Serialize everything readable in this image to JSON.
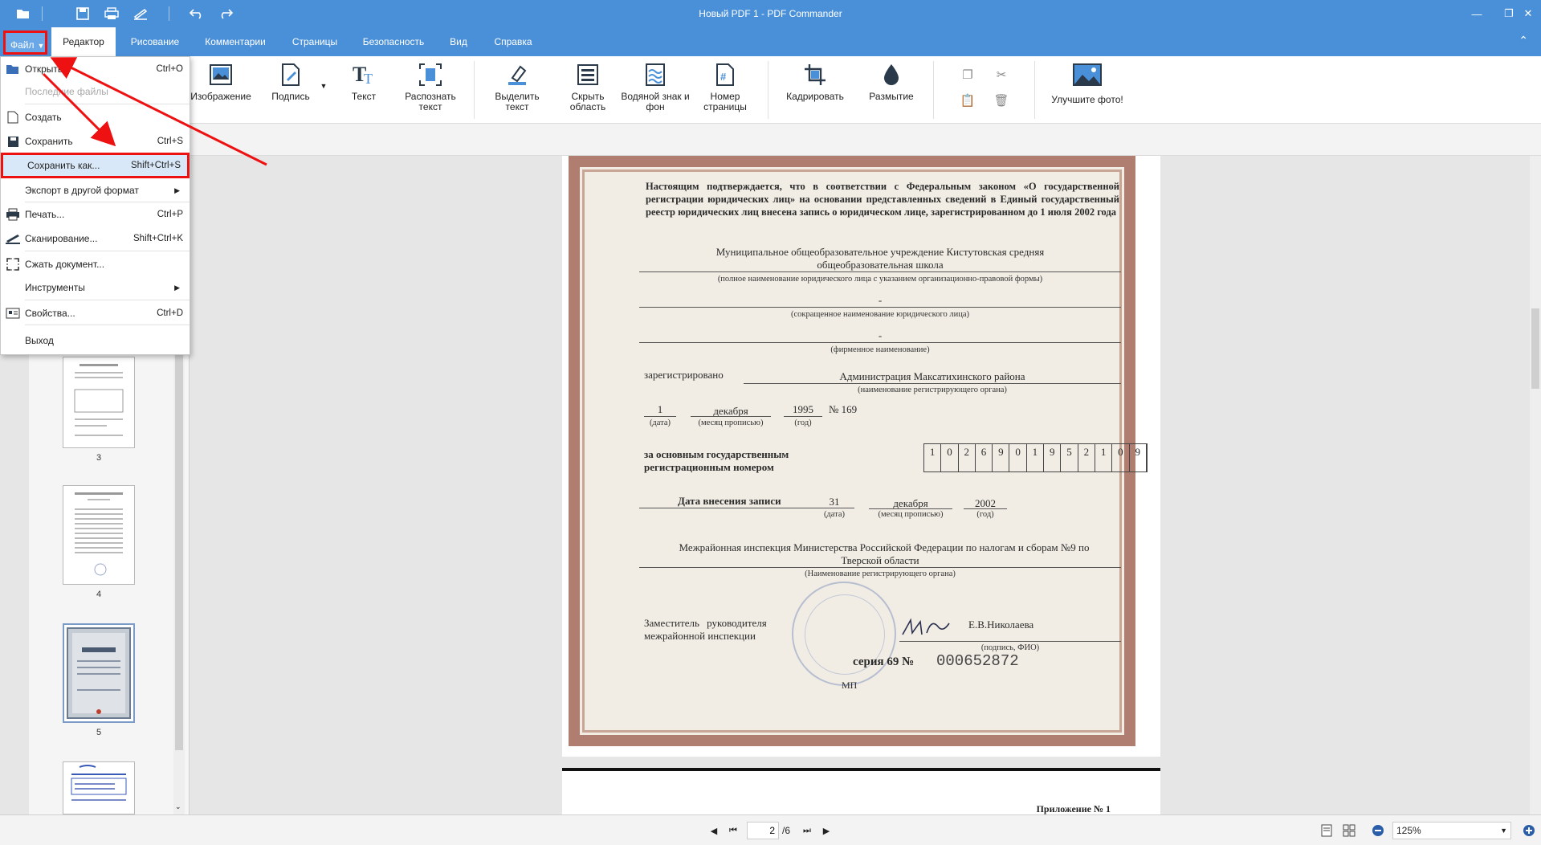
{
  "window": {
    "title": "Новый PDF 1 - PDF Commander"
  },
  "menubar": {
    "file": "Файл",
    "tabs": [
      "Редактор",
      "Рисование",
      "Комментарии",
      "Страницы",
      "Безопасность",
      "Вид",
      "Справка"
    ],
    "active_tab": "Редактор"
  },
  "ribbon": {
    "buttons": [
      {
        "label": "Изображение"
      },
      {
        "label": "Подпись"
      },
      {
        "label": "Текст"
      },
      {
        "label": "Распознать текст"
      },
      {
        "label": "Выделить текст"
      },
      {
        "label": "Скрыть область"
      },
      {
        "label": "Водяной знак и фон"
      },
      {
        "label": "Номер страницы"
      },
      {
        "label": "Кадрировать"
      },
      {
        "label": "Размытие"
      },
      {
        "label": "Улучшите фото!"
      }
    ]
  },
  "file_menu": {
    "items": [
      {
        "label": "Открыть...",
        "shortcut": "Ctrl+O"
      },
      {
        "label": "Последние файлы",
        "shortcut": ""
      },
      {
        "label": "Создать",
        "shortcut": ""
      },
      {
        "label": "Сохранить",
        "shortcut": "Ctrl+S"
      },
      {
        "label": "Сохранить как...",
        "shortcut": "Shift+Ctrl+S"
      },
      {
        "label": "Экспорт в другой формат",
        "shortcut": ""
      },
      {
        "label": "Печать...",
        "shortcut": "Ctrl+P"
      },
      {
        "label": "Сканирование...",
        "shortcut": "Shift+Ctrl+K"
      },
      {
        "label": "Сжать документ...",
        "shortcut": ""
      },
      {
        "label": "Инструменты",
        "shortcut": ""
      },
      {
        "label": "Свойства...",
        "shortcut": "Ctrl+D"
      },
      {
        "label": "Выход",
        "shortcut": ""
      }
    ]
  },
  "thumbnails": {
    "pages": [
      "3",
      "4",
      "5"
    ]
  },
  "certificate": {
    "intro": "Настоящим подтверждается, что в соответствии с Федеральным законом «О государственной регистрации юридических лиц» на основании представленных сведений в Единый государственный реестр юридических лиц внесена запись о юридическом лице, зарегистрированном до 1 июля 2002 года",
    "org_name_line1": "Муниципальное общеобразовательное учреждение Кистутовская средняя",
    "org_name_line2": "общеобразовательная школа",
    "caption_full_name": "(полное наименование юридического лица с указанием организационно-правовой формы)",
    "dash1": "-",
    "caption_short_name": "(сокращенное наименование юридического лица)",
    "dash2": "-",
    "caption_firm_name": "(фирменное наименование)",
    "registered_label": "зарегистрировано",
    "registered_by": "Администрация Максатихинского района",
    "caption_reg_organ": "(наименование регистрирующего органа)",
    "reg_day": "1",
    "reg_month": "декабря",
    "reg_year": "1995",
    "reg_number": "№  169",
    "caption_date": "(дата)",
    "caption_month": "(месяц прописью)",
    "caption_year": "(год)",
    "main_number_label_1": "за основным государственным",
    "main_number_label_2": "регистрационным номером",
    "ogrn_digits": [
      "1",
      "0",
      "2",
      "6",
      "9",
      "0",
      "1",
      "9",
      "5",
      "2",
      "1",
      "0",
      "9"
    ],
    "entry_date_label": "Дата внесения записи",
    "entry_day": "31",
    "entry_month": "декабря",
    "entry_year": "2002",
    "caption_date2": "(дата)",
    "caption_month2": "(месяц прописью)",
    "caption_year2": "(год)",
    "inspection_line1": "Межрайонная инспекция Министерства Российской Федерации по налогам и сборам №9 по",
    "inspection_line2": "Тверской области",
    "caption_inspection": "(Наименование регистрирующего органа)",
    "signer_line1": "Заместитель     руководителя",
    "signer_line2": "межрайонной инспекции",
    "signer_name": "Е.В.Николаева",
    "caption_signature": "(подпись, ФИО)",
    "series_label": "серия  69   №",
    "series_number": "000652872",
    "mp": "МП"
  },
  "page3": {
    "heading": "Приложение № 1"
  },
  "statusbar": {
    "current_page": "2",
    "total_pages": "/6",
    "zoom": "125%"
  }
}
